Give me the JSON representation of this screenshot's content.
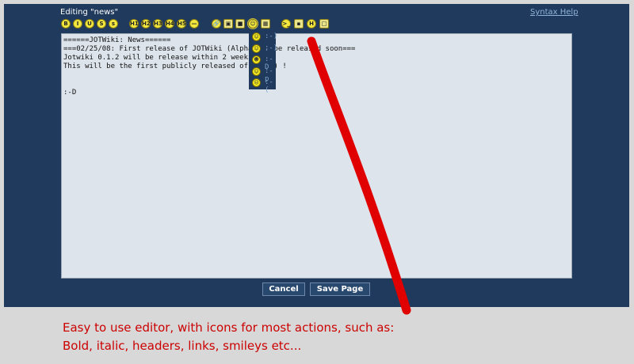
{
  "header": {
    "title": "Editing \"news\"",
    "help_link": "Syntax Help"
  },
  "toolbar": {
    "buttons": [
      {
        "name": "bold-button",
        "glyph": "B"
      },
      {
        "name": "italic-button",
        "glyph": "I"
      },
      {
        "name": "underline-button",
        "glyph": "U"
      },
      {
        "name": "strikethrough-button",
        "glyph": "S"
      },
      {
        "name": "small-button",
        "glyph": "s"
      },
      {
        "name": "heading1-button",
        "glyph": "H1"
      },
      {
        "name": "heading2-button",
        "glyph": "H2"
      },
      {
        "name": "heading3-button",
        "glyph": "H3"
      },
      {
        "name": "heading4-button",
        "glyph": "H4"
      },
      {
        "name": "heading5-button",
        "glyph": "H5"
      },
      {
        "name": "horizontal-rule-button",
        "glyph": "—"
      },
      {
        "name": "link-button",
        "glyph": "🔗"
      },
      {
        "name": "image-button",
        "glyph": "▣"
      },
      {
        "name": "block-button",
        "glyph": "■"
      },
      {
        "name": "smiley-button",
        "glyph": "☺"
      },
      {
        "name": "table-button",
        "glyph": "▦"
      },
      {
        "name": "code-button",
        "glyph": ">_"
      },
      {
        "name": "terminal-button",
        "glyph": "▪"
      },
      {
        "name": "html-button",
        "glyph": "H"
      },
      {
        "name": "box-button",
        "glyph": "□"
      }
    ]
  },
  "editor": {
    "lines": [
      "======JOTWiki: News======",
      "===02/25/08: First release of JOTWiki (Alpha) to be released soon===",
      "Jotwiki 0.1.2 will be release within 2 weeks.",
      "This will be the first publicly released of it :-) !",
      "",
      "",
      ":-D"
    ]
  },
  "smiley_menu": {
    "items": [
      ":-)",
      ";-)",
      ":-D",
      ":-p",
      ":-("
    ]
  },
  "actions": {
    "cancel": "Cancel",
    "save": "Save Page"
  },
  "caption": {
    "line1": "Easy to use editor, with icons for most actions, such as:",
    "line2": "Bold, italic, headers, links, smileys etc..."
  },
  "colors": {
    "panel": "#1f3a5c",
    "annotation": "#e00000",
    "caption": "#cc0000"
  }
}
